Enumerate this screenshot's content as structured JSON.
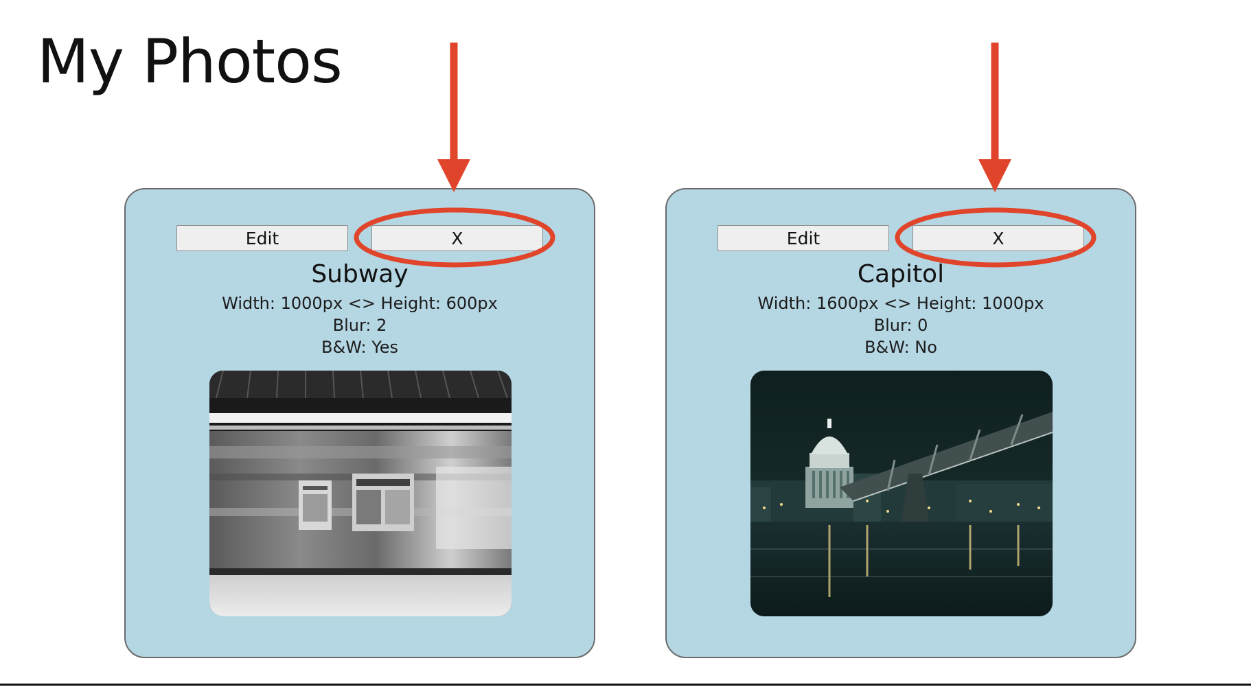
{
  "page": {
    "title": "My Photos"
  },
  "photos": [
    {
      "edit_label": "Edit",
      "delete_label": "X",
      "name": "Subway",
      "dimensions": "Width: 1000px <> Height: 600px",
      "blur": "Blur: 2",
      "bw": "B&W: Yes"
    },
    {
      "edit_label": "Edit",
      "delete_label": "X",
      "name": "Capitol",
      "dimensions": "Width: 1600px <> Height: 1000px",
      "blur": "Blur: 0",
      "bw": "B&W: No"
    }
  ],
  "colors": {
    "card_background": "#b5d6e3",
    "annotation": "#e0452b"
  },
  "icons": {
    "annotation_arrow": "arrow-down-icon",
    "annotation_highlight": "ellipse-highlight"
  }
}
